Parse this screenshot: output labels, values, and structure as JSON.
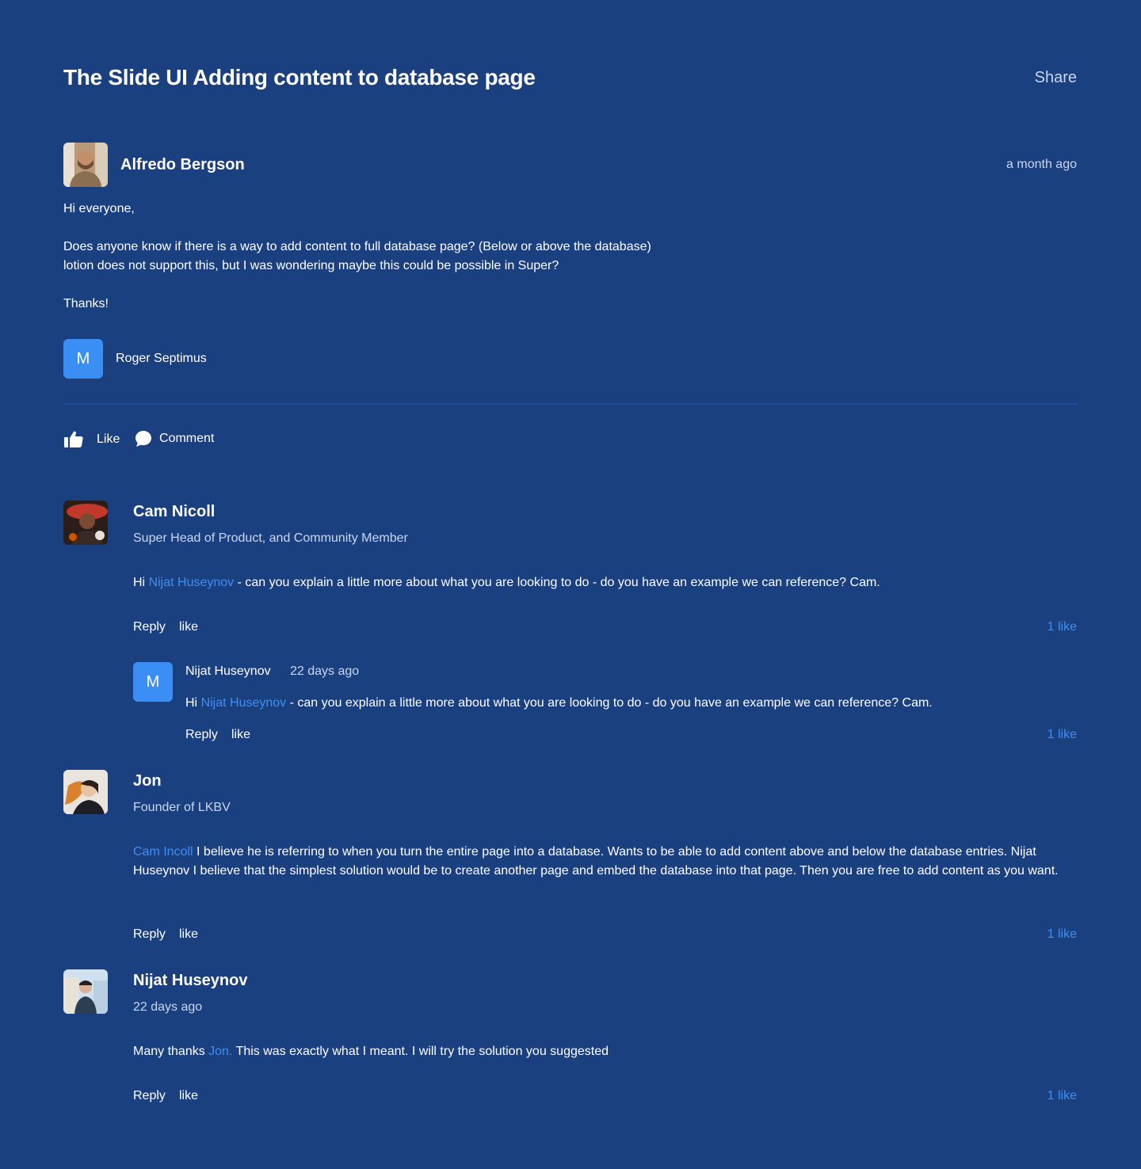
{
  "page": {
    "title": "The Slide UI Adding content to database page",
    "share_label": "Share"
  },
  "post": {
    "author": "Alfredo Bergson",
    "time": "a month ago",
    "greeting": "Hi everyone,",
    "line1": "Does anyone know if there is a way to add content to full database page? (Below or above the database)",
    "line2": "lotion does not support this, but I was wondering maybe this could be possible in Super?",
    "thanks": "Thanks!",
    "mention_initial": "M",
    "mention_name": "Roger Septimus",
    "like_label": "Like",
    "comment_label": "Comment"
  },
  "comments": [
    {
      "author": "Cam Nicoll",
      "subtitle": "Super Head of Product, and Community Member",
      "text_prefix": "Hi ",
      "mention": "Nijat Huseynov",
      "text_suffix": " - can you explain a little more about what you are looking to do - do you have an example we can reference? Cam.",
      "reply_label": "Reply",
      "like_label": "like",
      "like_count": "1 like",
      "reply": {
        "initial": "M",
        "author": "Nijat Huseynov",
        "time": "22 days ago",
        "text_prefix": "Hi ",
        "mention": "Nijat Huseynov",
        "text_suffix": " - can you explain a little more about what you are looking to do - do you have an example we can reference? Cam.",
        "reply_label": "Reply",
        "like_label": "like",
        "like_count": "1 like"
      }
    },
    {
      "author": "Jon",
      "subtitle": "Founder of LKBV",
      "mention": "Cam Incoll",
      "text_suffix": " I believe he is referring to when you turn the entire page into a database. Wants to be able to add content above and below the database entries. Nijat Huseynov I believe that the simplest solution would be to create another page and embed the database into that page. Then you are free to add content as you want.",
      "reply_label": "Reply",
      "like_label": "like",
      "like_count": "1 like"
    },
    {
      "author": "Nijat Huseynov",
      "subtitle": "22 days ago",
      "text_prefix": "Many thanks ",
      "mention": "Jon.",
      "text_suffix": " This was exactly what I meant. I will try the solution you suggested",
      "reply_label": "Reply",
      "like_label": "like",
      "like_count": "1 like"
    }
  ],
  "colors": {
    "background": "#1b407f",
    "accent": "#3e8ff4",
    "muted_text": "#c9d6ef"
  }
}
